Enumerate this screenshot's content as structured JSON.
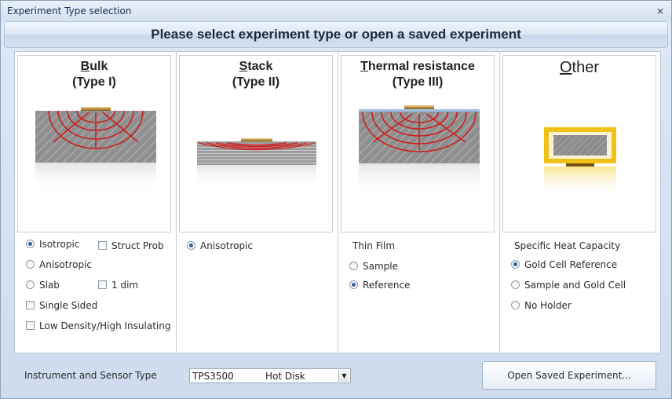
{
  "window": {
    "title": "Experiment Type selection",
    "close_glyph": "⨯"
  },
  "header": {
    "text": "Please select experiment type or open a saved experiment"
  },
  "cards": {
    "bulk": {
      "first": "B",
      "rest": "ulk",
      "sub": "(Type I)"
    },
    "stack": {
      "first": "S",
      "rest": "tack",
      "sub": "(Type II)"
    },
    "thermal": {
      "first": "T",
      "rest": "hermal resistance",
      "sub": "(Type III)"
    },
    "other": {
      "first": "O",
      "rest": "ther"
    }
  },
  "bulk_options": {
    "isotropic": "Isotropic",
    "struct_prob": "Struct Prob",
    "anisotropic": "Anisotropic",
    "slab": "Slab",
    "one_dim": "1 dim",
    "single_sided": "Single Sided",
    "low_density": "Low Density/High Insulating"
  },
  "stack_options": {
    "anisotropic": "Anisotropic"
  },
  "thermal_options": {
    "group": "Thin Film",
    "sample": "Sample",
    "reference": "Reference"
  },
  "other_options": {
    "group": "Specific Heat Capacity",
    "gold_cell_reference": "Gold Cell Reference",
    "sample_and_gold_cell": "Sample and Gold Cell",
    "no_holder": "No Holder"
  },
  "footer": {
    "instrument_label": "Instrument and Sensor Type",
    "instrument_model": "TPS3500",
    "sensor_type": "Hot Disk",
    "open_button": "Open Saved Experiment..."
  },
  "colors": {
    "accent_red": "#cc1f1f",
    "sensor_gold": "#b8860b",
    "gold_cell": "#f2c418",
    "radio_dot": "#3a5f9e"
  },
  "icons": {
    "close": "close-icon",
    "combo_arrow": "chevron-down-icon"
  }
}
